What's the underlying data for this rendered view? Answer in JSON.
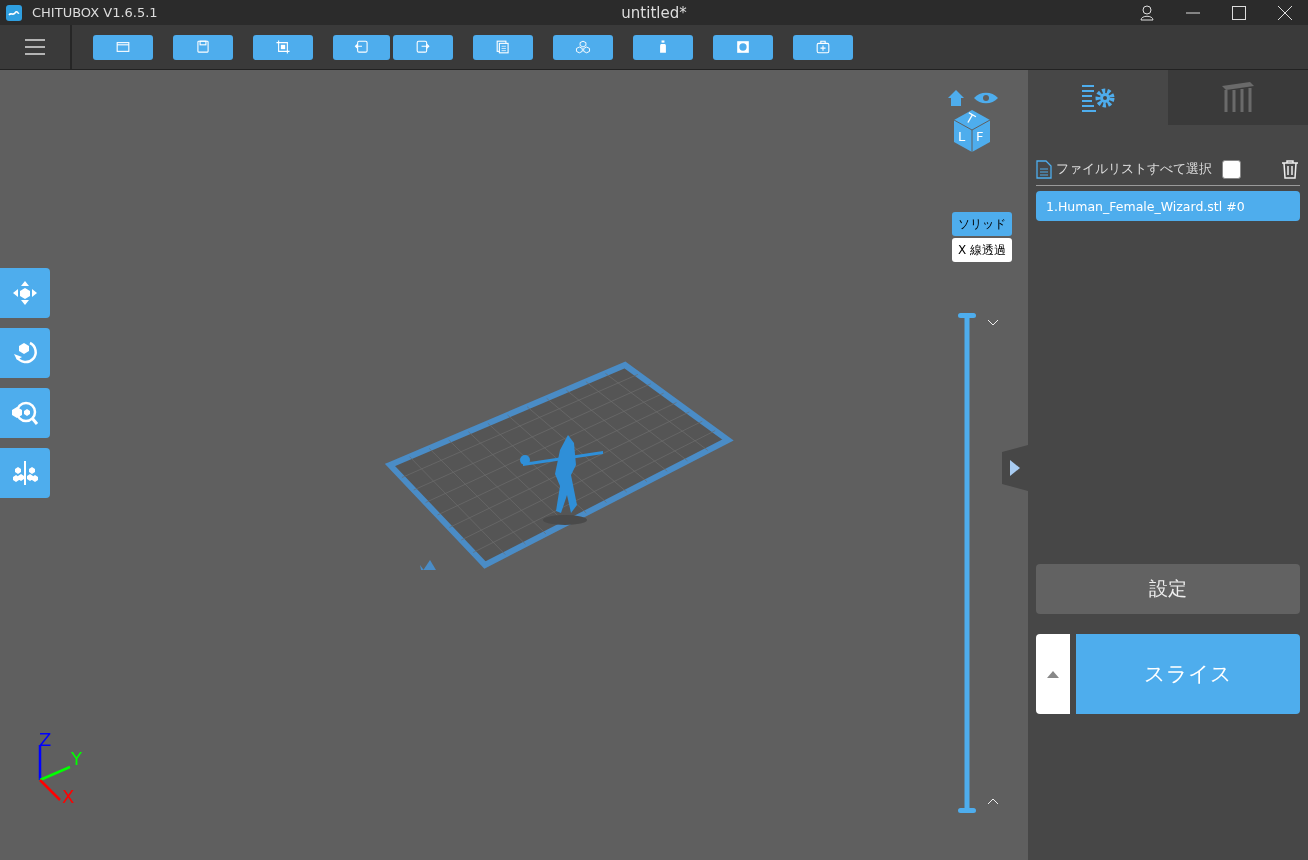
{
  "window": {
    "app_title": "CHITUBOX V1.6.5.1",
    "document_title": "untitled*"
  },
  "view_modes": [
    {
      "label": "ソリッド",
      "selected": true
    },
    {
      "label": "X 線透過",
      "selected": false
    }
  ],
  "side_tabs": [
    {
      "kind": "settings",
      "selected": true
    },
    {
      "kind": "supports",
      "selected": false
    }
  ],
  "file_list": {
    "header": "ファイルリストすべて選択",
    "select_all_checked": false,
    "items": [
      {
        "label": "1.Human_Female_Wizard.stl #0",
        "selected": true
      }
    ]
  },
  "view_cube_faces": [
    "T",
    "L",
    "F"
  ],
  "layer_slider": {
    "level": 1
  },
  "settings_button": "設定",
  "slice_button": "スライス",
  "axes": [
    {
      "label": "Z",
      "color": "#0000ff"
    },
    {
      "label": "Y",
      "color": "#00ff00"
    },
    {
      "label": "X",
      "color": "#ff0000"
    }
  ]
}
